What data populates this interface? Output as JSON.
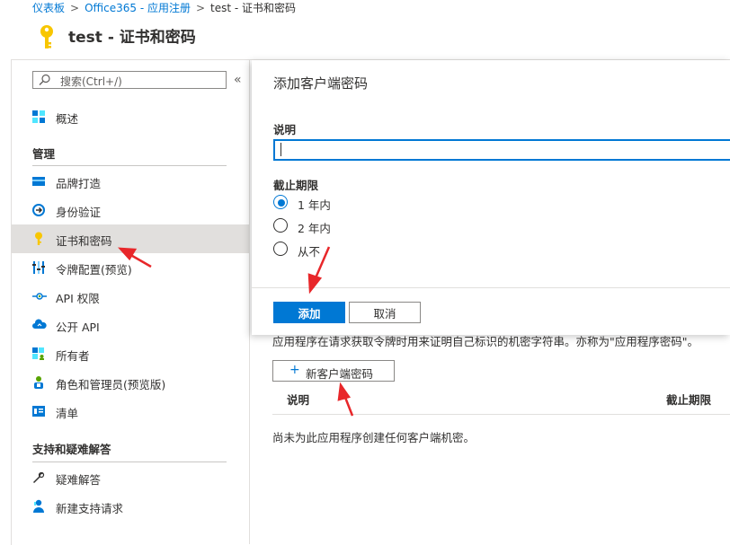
{
  "breadcrumb": {
    "items": [
      "仪表板",
      "Office365 - 应用注册",
      "test - 证书和密码"
    ],
    "separator": ">"
  },
  "page": {
    "title": "test - 证书和密码"
  },
  "sidebar": {
    "search_placeholder": "搜索(Ctrl+/)",
    "collapse_glyph": "«",
    "overview": "概述",
    "section_manage": "管理",
    "section_support": "支持和疑难解答",
    "items": [
      {
        "label": "品牌打造",
        "icon": "branding-icon"
      },
      {
        "label": "身份验证",
        "icon": "authentication-icon"
      },
      {
        "label": "证书和密码",
        "icon": "key-icon",
        "active": true
      },
      {
        "label": "令牌配置(预览)",
        "icon": "token-config-icon"
      },
      {
        "label": "API 权限",
        "icon": "api-permissions-icon"
      },
      {
        "label": "公开 API",
        "icon": "cloud-icon"
      },
      {
        "label": "所有者",
        "icon": "owners-icon"
      },
      {
        "label": "角色和管理员(预览版)",
        "icon": "roles-admins-icon"
      },
      {
        "label": "清单",
        "icon": "manifest-icon"
      }
    ],
    "support_items": [
      {
        "label": "疑难解答",
        "icon": "wrench-icon"
      },
      {
        "label": "新建支持请求",
        "icon": "support-person-icon"
      }
    ]
  },
  "main": {
    "description": "应用程序在请求获取令牌时用来证明自己标识的机密字符串。亦称为\"应用程序密码\"。",
    "new_secret_label": "新客户端密码",
    "col_description": "说明",
    "col_expires": "截止期限",
    "empty_message": "尚未为此应用程序创建任何客户端机密。"
  },
  "panel": {
    "title": "添加客户端密码",
    "description_label": "说明",
    "description_value": "",
    "expires_label": "截止期限",
    "options": [
      {
        "label": "1 年内",
        "selected": true
      },
      {
        "label": "2 年内",
        "selected": false
      },
      {
        "label": "从不",
        "selected": false
      }
    ],
    "add_label": "添加",
    "cancel_label": "取消"
  },
  "colors": {
    "accent": "#0078d4",
    "key_yellow": "#f8c600",
    "arrow_red": "#e8272a"
  }
}
